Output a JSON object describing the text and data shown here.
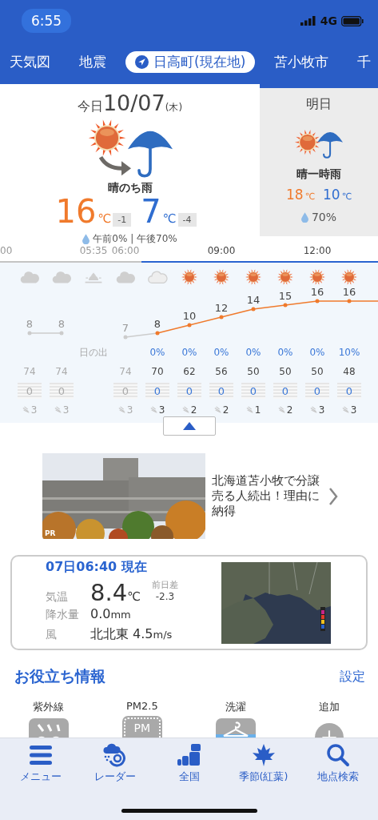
{
  "status_bar": {
    "time": "6:55",
    "network": "4G"
  },
  "tabs": [
    {
      "label": "天気図",
      "selected": false
    },
    {
      "label": "地震",
      "selected": false
    },
    {
      "label": "日高町(現在地)",
      "selected": true
    },
    {
      "label": "苫小牧市",
      "selected": false
    },
    {
      "label": "千",
      "selected": false
    }
  ],
  "today": {
    "label": "今日",
    "date": "10/07",
    "weekday": "(木)",
    "kind": "sun_then_rain",
    "weather": "晴のち雨",
    "high": "16",
    "high_unit": "℃",
    "high_diff": "-1",
    "low": "7",
    "low_unit": "℃",
    "low_diff": "-4",
    "rain": "午前0% | 午後70%"
  },
  "tomorrow": {
    "label": "明日",
    "kind": "sun_sometimes_rain",
    "weather": "晴一時雨",
    "high": "18",
    "high_unit": "℃",
    "low": "10",
    "low_unit": "℃",
    "rain": "70%"
  },
  "hourly": {
    "leading_time": "00",
    "columns": [
      {
        "kind": "cloud",
        "temp": "8",
        "past": true,
        "humidity": "74",
        "precip": "0",
        "wind": "3"
      },
      {
        "kind": "cloud",
        "temp": "8",
        "past": true,
        "humidity": "74",
        "precip": "0",
        "wind": "3"
      },
      {
        "kind": "sunrise",
        "time": "05:35",
        "label": "日の出",
        "past": true
      },
      {
        "kind": "cloud",
        "time": "06:00",
        "temp": "7",
        "past": true,
        "humidity": "74",
        "precip": "0",
        "wind": "3"
      },
      {
        "kind": "cloud_outline",
        "temp": "8",
        "past": false,
        "rain": "0%",
        "humidity": "70",
        "precip": "0",
        "wind": "3"
      },
      {
        "kind": "sun",
        "temp": "10",
        "past": false,
        "rain": "0%",
        "humidity": "62",
        "precip": "0",
        "wind": "2"
      },
      {
        "kind": "sun",
        "time": "09:00",
        "temp": "12",
        "past": false,
        "rain": "0%",
        "humidity": "56",
        "precip": "0",
        "wind": "2"
      },
      {
        "kind": "sun",
        "temp": "14",
        "past": false,
        "rain": "0%",
        "humidity": "50",
        "precip": "0",
        "wind": "1"
      },
      {
        "kind": "sun",
        "temp": "15",
        "past": false,
        "rain": "0%",
        "humidity": "50",
        "precip": "0",
        "wind": "2"
      },
      {
        "kind": "sun",
        "time": "12:00",
        "temp": "16",
        "past": false,
        "rain": "0%",
        "humidity": "50",
        "precip": "0",
        "wind": "3"
      },
      {
        "kind": "sun",
        "temp": "16",
        "past": false,
        "rain": "10%",
        "humidity": "48",
        "precip": "0",
        "wind": "3"
      }
    ]
  },
  "ad": {
    "badge": "PR",
    "text": "北海道苫小牧で分譲売る人続出！理由に納得"
  },
  "observation": {
    "title": "07日06:40 現在",
    "rows": [
      {
        "kind": "temp",
        "label": "気温",
        "value": "8.4",
        "unit": "℃",
        "diff_label": "前日差",
        "diff": "-2.3"
      },
      {
        "kind": "plain",
        "label": "降水量",
        "value": "0.0",
        "unit": "mm"
      },
      {
        "kind": "plain",
        "label": "風",
        "value": "北北東 4.5",
        "unit": "m/s"
      }
    ]
  },
  "info": {
    "title": "お役立ち情報",
    "settings": "設定",
    "items": [
      {
        "label": "紫外線",
        "kind": "uv"
      },
      {
        "label": "PM2.5",
        "kind": "pm",
        "icon_text": "PM"
      },
      {
        "label": "洗濯",
        "kind": "laundry"
      },
      {
        "label": "追加",
        "kind": "add"
      }
    ]
  },
  "nav": [
    {
      "label": "メニュー",
      "kind": "menu"
    },
    {
      "label": "レーダー",
      "kind": "radar"
    },
    {
      "label": "全国",
      "kind": "nation"
    },
    {
      "label": "季節(紅葉)",
      "kind": "season"
    },
    {
      "label": "地点検索",
      "kind": "search"
    }
  ]
}
